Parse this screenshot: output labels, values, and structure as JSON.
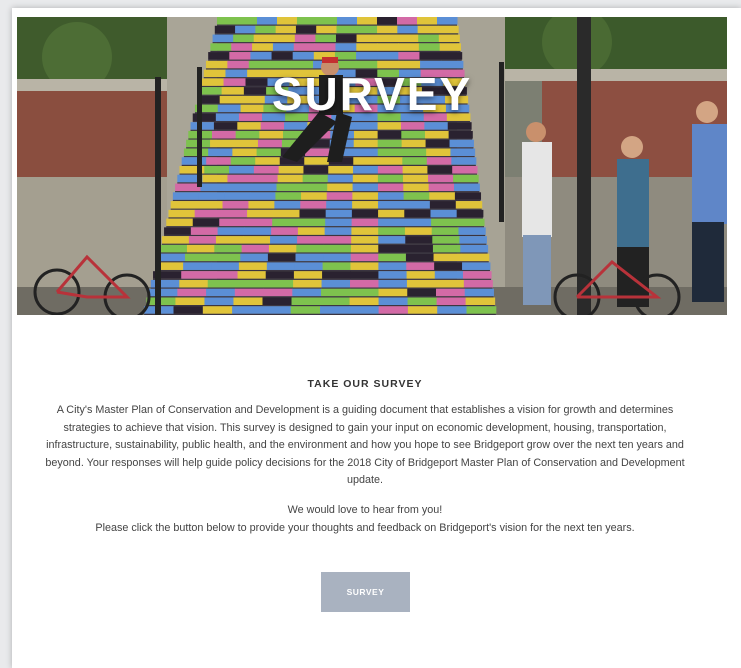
{
  "hero": {
    "title": "SURVEY"
  },
  "section": {
    "heading": "TAKE OUR SURVEY",
    "description": "A City's Master Plan of Conservation and Development is a guiding document that establishes a vision for growth and determines strategies to achieve that vision. This survey is designed to gain your input on economic development, housing, transportation, infrastructure, sustainability, public health, and the environment and how you hope to see Bridgeport grow over the next ten years and beyond. Your responses will help guide policy decisions for the 2018 City of Bridgeport Master Plan of Conservation and Development update.",
    "invite_line": "We would love to hear from you!",
    "instruction_line": "Please click the button below to provide your thoughts and feedback on Bridgeport's vision for the next ten years."
  },
  "survey_button": {
    "label": "SURVEY"
  },
  "colors": {
    "button_bg": "#a9b2c0",
    "page_bg": "#e9eaec",
    "stair_blue": "#5b8fd6",
    "stair_yellow": "#e0c43a",
    "stair_pink": "#d36aa6",
    "stair_green": "#7ec24e",
    "stair_black": "#2a2230"
  }
}
